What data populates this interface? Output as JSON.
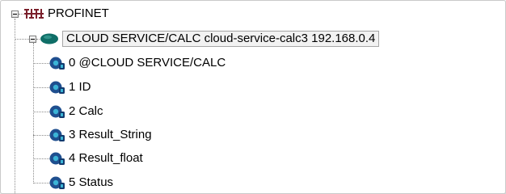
{
  "tree": {
    "root": {
      "label": "PROFINET",
      "icon": "profinet-network-icon",
      "expanded": true
    },
    "device": {
      "label": "CLOUD SERVICE/CALC cloud-service-calc3 192.168.0.4",
      "icon": "device-icon",
      "expanded": true,
      "selected": true
    },
    "slots": [
      {
        "label": "0 @CLOUD SERVICE/CALC",
        "icon": "module-icon"
      },
      {
        "label": "1 ID",
        "icon": "module-icon"
      },
      {
        "label": "2 Calc",
        "icon": "module-icon"
      },
      {
        "label": "3 Result_String",
        "icon": "module-icon"
      },
      {
        "label": "4 Result_float",
        "icon": "module-icon"
      },
      {
        "label": "5 Status",
        "icon": "module-icon"
      }
    ]
  },
  "colors": {
    "network_icon": "#7a1f2b",
    "device_icon": "#0f6e67",
    "module_icon": "#1f4f8f",
    "module_accent": "#3bb4d6"
  }
}
